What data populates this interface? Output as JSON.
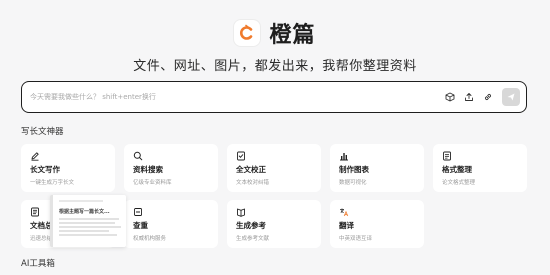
{
  "brand": {
    "name": "橙篇",
    "accent": "#f07b2d"
  },
  "slogan": "文件、网址、图片，都发出来，我帮你整理资料",
  "prompt": {
    "placeholder": "今天需要我做些什么？ shift+enter换行",
    "tools": [
      "cube-icon",
      "upload-icon",
      "link-icon"
    ],
    "send_icon": "send-icon"
  },
  "sections": {
    "writing": "写长文神器",
    "ai_tools": "AI工具箱"
  },
  "cards": [
    {
      "icon": "pen-icon",
      "title": "长文写作",
      "subtitle": "一键生成万字长文"
    },
    {
      "icon": "search-icon",
      "title": "资料搜索",
      "subtitle": "亿级专业资料库"
    },
    {
      "icon": "doc-check-icon",
      "title": "全文校正",
      "subtitle": "文本校对纠错"
    },
    {
      "icon": "bar-chart-icon",
      "title": "制作图表",
      "subtitle": "数据可视化"
    },
    {
      "icon": "format-icon",
      "title": "格式整理",
      "subtitle": "论文格式整理"
    },
    {
      "icon": "summary-icon",
      "title": "文档总结",
      "subtitle": "迅速总结要点"
    },
    {
      "icon": "dup-check-icon",
      "title": "查重",
      "subtitle": "权威机构服务"
    },
    {
      "icon": "reference-icon",
      "title": "生成参考",
      "subtitle": "生成参考文献"
    },
    {
      "icon": "translate-icon",
      "title": "翻译",
      "subtitle": "中英双语互译"
    }
  ],
  "preview": {
    "title": "根据主题写一篇长文..."
  }
}
